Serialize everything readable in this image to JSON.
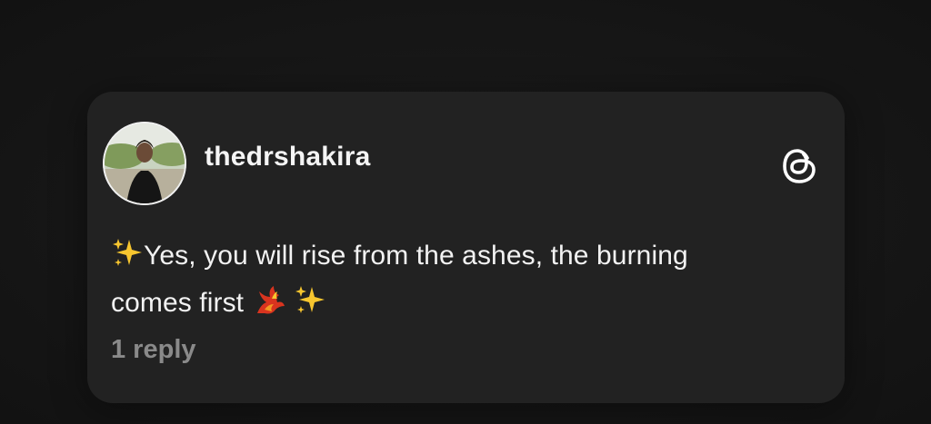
{
  "post": {
    "username": "thedrshakira",
    "text_line1": "Yes, you will rise from the ashes, the burning",
    "text_line2": "comes first",
    "reply_count": "1 reply"
  },
  "icons": {
    "brand": "threads-logo-icon",
    "emoji_sparkles": "sparkles-icon",
    "emoji_phoenix": "phoenix-icon"
  },
  "colors": {
    "background": "#161616",
    "card": "#222222",
    "text": "#f2f2f2",
    "muted": "#8a8a8a",
    "sparkle": "#f7c62f",
    "phoenix": "#d9341f"
  }
}
